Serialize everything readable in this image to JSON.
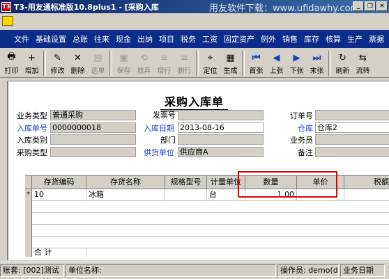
{
  "window": {
    "title": "T3-用友通标准版10.8plus1 - [采购入库",
    "watermark": "用友软件下载：www.ufidawhy.com",
    "app_icon": "T3"
  },
  "menu": [
    "文件",
    "基础设置",
    "总账",
    "往来",
    "现金",
    "出纳",
    "项目",
    "税务",
    "工资",
    "固定资产",
    "例外",
    "销售",
    "库存",
    "核算",
    "生产",
    "票据"
  ],
  "toolbar": [
    {
      "label": "打印",
      "icon": "printer-icon",
      "glyph": "🖶",
      "enabled": true
    },
    {
      "label": "增加",
      "icon": "add-doc-icon",
      "glyph": "+",
      "enabled": true
    },
    {
      "label": "修改",
      "icon": "edit-icon",
      "glyph": "✎",
      "enabled": true
    },
    {
      "label": "删除",
      "icon": "delete-icon",
      "glyph": "✕",
      "enabled": true
    },
    {
      "label": "选单",
      "icon": "select-icon",
      "glyph": "▤",
      "enabled": false
    },
    {
      "label": "保存",
      "icon": "save-icon",
      "glyph": "▣",
      "enabled": false
    },
    {
      "label": "放弃",
      "icon": "discard-icon",
      "glyph": "⟲",
      "enabled": false
    },
    {
      "label": "增行",
      "icon": "add-row-icon",
      "glyph": "≡",
      "enabled": false
    },
    {
      "label": "删行",
      "icon": "delete-row-icon",
      "glyph": "≡",
      "enabled": false
    },
    {
      "label": "定位",
      "icon": "locate-icon",
      "glyph": "⌖",
      "enabled": true
    },
    {
      "label": "生成",
      "icon": "generate-icon",
      "glyph": "▦",
      "enabled": true
    },
    {
      "label": "首张",
      "icon": "first-icon",
      "glyph": "⏮",
      "enabled": true
    },
    {
      "label": "上张",
      "icon": "prev-icon",
      "glyph": "◀",
      "enabled": true
    },
    {
      "label": "下张",
      "icon": "next-icon",
      "glyph": "▶",
      "enabled": true
    },
    {
      "label": "末张",
      "icon": "last-icon",
      "glyph": "⏭",
      "enabled": true
    },
    {
      "label": "刷新",
      "icon": "refresh-icon",
      "glyph": "↻",
      "enabled": true
    },
    {
      "label": "流转",
      "icon": "flow-icon",
      "glyph": "⇆",
      "enabled": true
    }
  ],
  "form": {
    "title": "采购入库单",
    "fields": {
      "business_type": {
        "label": "业务类型",
        "value": "普通采购"
      },
      "invoice_no": {
        "label": "发票号",
        "value": ""
      },
      "order_no": {
        "label": "订单号",
        "value": ""
      },
      "receipt_no": {
        "label": "入库单号",
        "value": "0000000018"
      },
      "receipt_date": {
        "label": "入库日期",
        "value": "2013-08-16"
      },
      "warehouse": {
        "label": "仓库",
        "value": "仓库2"
      },
      "receipt_category": {
        "label": "入库类别",
        "value": ""
      },
      "department": {
        "label": "部门",
        "value": ""
      },
      "salesperson": {
        "label": "业务员",
        "value": ""
      },
      "purchase_type": {
        "label": "采购类型",
        "value": ""
      },
      "supplier": {
        "label": "供货单位",
        "value": "供应商A"
      },
      "remark": {
        "label": "备注",
        "value": ""
      }
    }
  },
  "grid": {
    "columns": [
      "存货编码",
      "存货名称",
      "规格型号",
      "计量单位",
      "数量",
      "单价",
      "税额"
    ],
    "rows": [
      {
        "marker": "*",
        "code": "10",
        "name": "冰箱",
        "spec": "",
        "unit": "台",
        "qty": "1.00",
        "price": "",
        "tax": ""
      }
    ],
    "total_label": "合  计"
  },
  "status": {
    "account": "账套: [002]测试",
    "unit_name": "单位名称:",
    "operator": "操作员: demo(de",
    "business_date": "业务日期"
  },
  "colors": {
    "menu_bg": "#0a2d8a",
    "title_bg": "#0a246a",
    "highlight": "#e00000",
    "blue_label": "#1a3fd8"
  }
}
